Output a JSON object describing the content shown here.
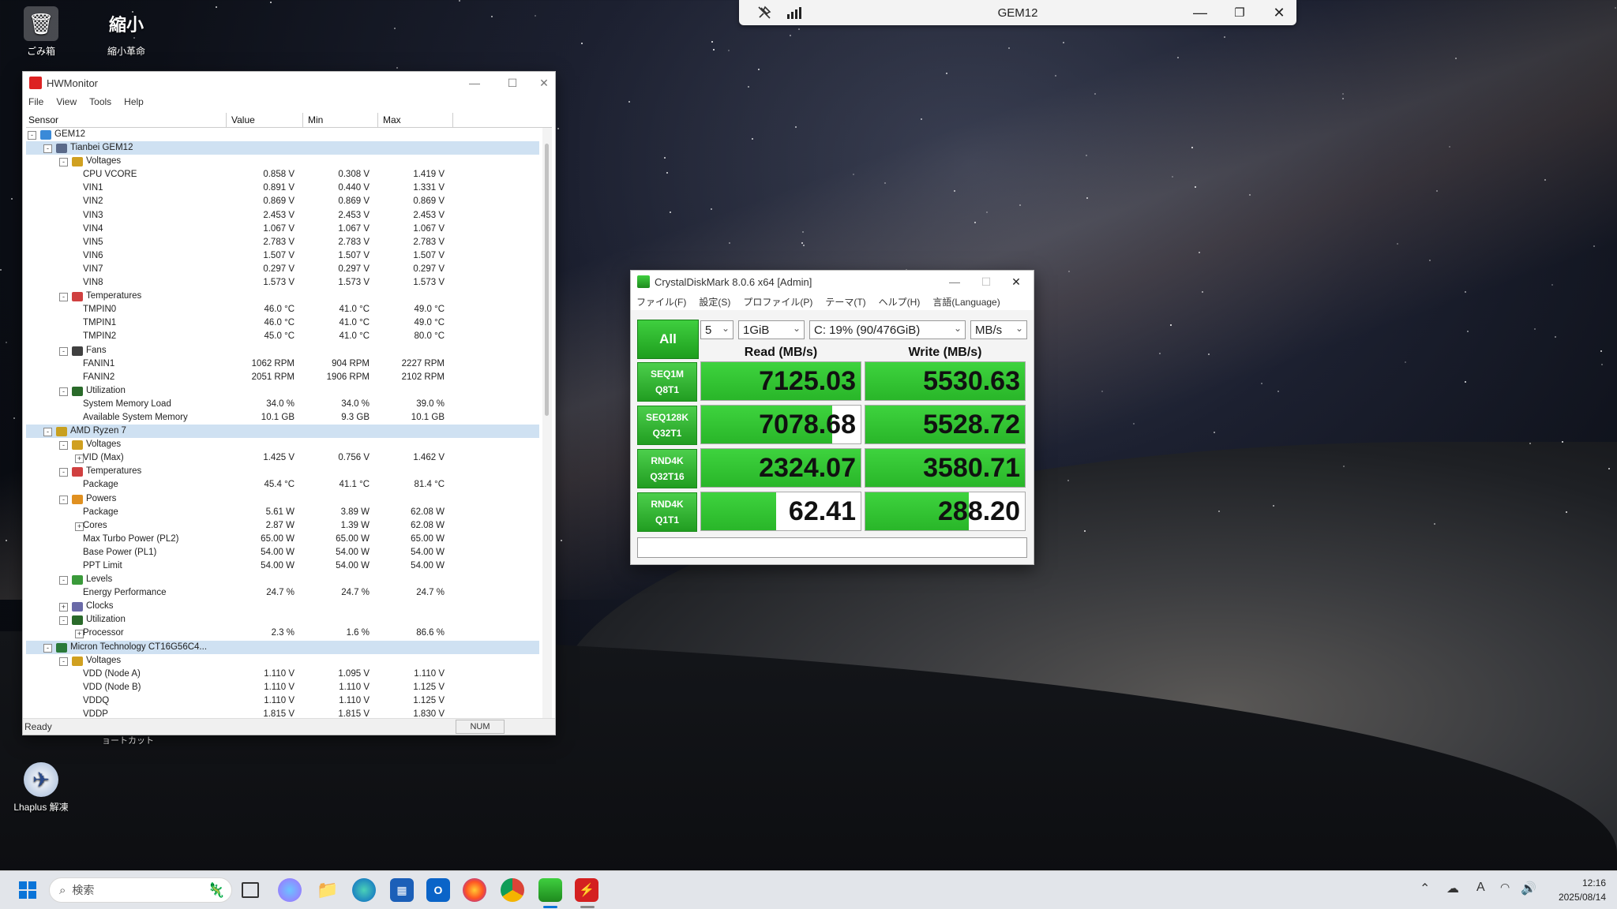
{
  "desktop": {
    "icons": [
      {
        "label": "ごみ箱",
        "icon": "recycle-bin-icon"
      },
      {
        "label": "縮小革命",
        "icon": "app-shortcut-icon"
      },
      {
        "label": "Lhaplus 解凍",
        "icon": "lhaplus-icon"
      }
    ],
    "shortcut_text": "ョートカット"
  },
  "remote_bar": {
    "title": "GEM12",
    "icons": [
      "pin-off-icon",
      "signal-bars-icon",
      "minimize-icon",
      "restore-icon",
      "close-icon"
    ]
  },
  "hwmonitor": {
    "title": "HWMonitor",
    "menu": [
      "File",
      "View",
      "Tools",
      "Help"
    ],
    "columns": [
      "Sensor",
      "Value",
      "Min",
      "Max"
    ],
    "status": "Ready",
    "num_indicator": "NUM",
    "rows": [
      {
        "level": 0,
        "exp": "-",
        "icon": "computer",
        "name": "GEM12",
        "sel": false
      },
      {
        "level": 1,
        "exp": "-",
        "icon": "board",
        "name": "Tianbei GEM12",
        "sel": true
      },
      {
        "level": 2,
        "exp": "-",
        "icon": "volt",
        "name": "Voltages"
      },
      {
        "level": 3,
        "name": "CPU VCORE",
        "value": "0.858 V",
        "min": "0.308 V",
        "max": "1.419 V"
      },
      {
        "level": 3,
        "name": "VIN1",
        "value": "0.891 V",
        "min": "0.440 V",
        "max": "1.331 V"
      },
      {
        "level": 3,
        "name": "VIN2",
        "value": "0.869 V",
        "min": "0.869 V",
        "max": "0.869 V"
      },
      {
        "level": 3,
        "name": "VIN3",
        "value": "2.453 V",
        "min": "2.453 V",
        "max": "2.453 V"
      },
      {
        "level": 3,
        "name": "VIN4",
        "value": "1.067 V",
        "min": "1.067 V",
        "max": "1.067 V"
      },
      {
        "level": 3,
        "name": "VIN5",
        "value": "2.783 V",
        "min": "2.783 V",
        "max": "2.783 V"
      },
      {
        "level": 3,
        "name": "VIN6",
        "value": "1.507 V",
        "min": "1.507 V",
        "max": "1.507 V"
      },
      {
        "level": 3,
        "name": "VIN7",
        "value": "0.297 V",
        "min": "0.297 V",
        "max": "0.297 V"
      },
      {
        "level": 3,
        "name": "VIN8",
        "value": "1.573 V",
        "min": "1.573 V",
        "max": "1.573 V"
      },
      {
        "level": 2,
        "exp": "-",
        "icon": "temp",
        "name": "Temperatures"
      },
      {
        "level": 3,
        "name": "TMPIN0",
        "value": "46.0 °C",
        "min": "41.0 °C",
        "max": "49.0 °C"
      },
      {
        "level": 3,
        "name": "TMPIN1",
        "value": "46.0 °C",
        "min": "41.0 °C",
        "max": "49.0 °C"
      },
      {
        "level": 3,
        "name": "TMPIN2",
        "value": "45.0 °C",
        "min": "41.0 °C",
        "max": "80.0 °C"
      },
      {
        "level": 2,
        "exp": "-",
        "icon": "fan",
        "name": "Fans"
      },
      {
        "level": 3,
        "name": "FANIN1",
        "value": "1062 RPM",
        "min": "904 RPM",
        "max": "2227 RPM"
      },
      {
        "level": 3,
        "name": "FANIN2",
        "value": "2051 RPM",
        "min": "1906 RPM",
        "max": "2102 RPM"
      },
      {
        "level": 2,
        "exp": "-",
        "icon": "util",
        "name": "Utilization"
      },
      {
        "level": 3,
        "name": "System Memory Load",
        "value": "34.0 %",
        "min": "34.0 %",
        "max": "39.0 %"
      },
      {
        "level": 3,
        "name": "Available System Memory",
        "value": "10.1 GB",
        "min": "9.3 GB",
        "max": "10.1 GB"
      },
      {
        "level": 1,
        "exp": "-",
        "icon": "cpu",
        "name": "AMD Ryzen 7",
        "sel": true
      },
      {
        "level": 2,
        "exp": "-",
        "icon": "volt",
        "name": "Voltages"
      },
      {
        "level": 3,
        "exp": "+",
        "name": "VID (Max)",
        "value": "1.425 V",
        "min": "0.756 V",
        "max": "1.462 V"
      },
      {
        "level": 2,
        "exp": "-",
        "icon": "temp",
        "name": "Temperatures"
      },
      {
        "level": 3,
        "name": "Package",
        "value": "45.4 °C",
        "min": "41.1 °C",
        "max": "81.4 °C"
      },
      {
        "level": 2,
        "exp": "-",
        "icon": "power",
        "name": "Powers"
      },
      {
        "level": 3,
        "name": "Package",
        "value": "5.61 W",
        "min": "3.89 W",
        "max": "62.08 W"
      },
      {
        "level": 3,
        "exp": "+",
        "name": "Cores",
        "value": "2.87 W",
        "min": "1.39 W",
        "max": "62.08 W"
      },
      {
        "level": 3,
        "name": "Max Turbo Power (PL2)",
        "value": "65.00 W",
        "min": "65.00 W",
        "max": "65.00 W"
      },
      {
        "level": 3,
        "name": "Base Power (PL1)",
        "value": "54.00 W",
        "min": "54.00 W",
        "max": "54.00 W"
      },
      {
        "level": 3,
        "name": "PPT Limit",
        "value": "54.00 W",
        "min": "54.00 W",
        "max": "54.00 W"
      },
      {
        "level": 2,
        "exp": "-",
        "icon": "levels",
        "name": "Levels"
      },
      {
        "level": 3,
        "name": "Energy Performance",
        "value": "24.7 %",
        "min": "24.7 %",
        "max": "24.7 %"
      },
      {
        "level": 2,
        "exp": "+",
        "icon": "clock",
        "name": "Clocks"
      },
      {
        "level": 2,
        "exp": "-",
        "icon": "util",
        "name": "Utilization"
      },
      {
        "level": 3,
        "exp": "+",
        "name": "Processor",
        "value": "2.3 %",
        "min": "1.6 %",
        "max": "86.6 %"
      },
      {
        "level": 1,
        "exp": "-",
        "icon": "ram",
        "name": "Micron Technology CT16G56C4...",
        "sel": true
      },
      {
        "level": 2,
        "exp": "-",
        "icon": "volt",
        "name": "Voltages"
      },
      {
        "level": 3,
        "name": "VDD (Node A)",
        "value": "1.110 V",
        "min": "1.095 V",
        "max": "1.110 V"
      },
      {
        "level": 3,
        "name": "VDD (Node B)",
        "value": "1.110 V",
        "min": "1.110 V",
        "max": "1.125 V"
      },
      {
        "level": 3,
        "name": "VDDQ",
        "value": "1.110 V",
        "min": "1.110 V",
        "max": "1.125 V"
      },
      {
        "level": 3,
        "name": "VDDP",
        "value": "1.815 V",
        "min": "1.815 V",
        "max": "1.830 V"
      }
    ]
  },
  "cdm": {
    "title": "CrystalDiskMark 8.0.6 x64 [Admin]",
    "menu": [
      "ファイル(F)",
      "設定(S)",
      "プロファイル(P)",
      "テーマ(T)",
      "ヘルプ(H)",
      "言語(Language)"
    ],
    "all_button": "All",
    "count": "5",
    "size": "1GiB",
    "drive": "C: 19% (90/476GiB)",
    "unit": "MB/s",
    "read_header": "Read (MB/s)",
    "write_header": "Write (MB/s)",
    "tests": [
      {
        "l1": "SEQ1M",
        "l2": "Q8T1",
        "read": "7125.03",
        "write": "5530.63",
        "read_fill": 1.0,
        "write_fill": 1.0
      },
      {
        "l1": "SEQ128K",
        "l2": "Q32T1",
        "read": "7078.68",
        "write": "5528.72",
        "read_fill": 0.82,
        "write_fill": 1.0
      },
      {
        "l1": "RND4K",
        "l2": "Q32T16",
        "read": "2324.07",
        "write": "3580.71",
        "read_fill": 1.0,
        "write_fill": 1.0
      },
      {
        "l1": "RND4K",
        "l2": "Q1T1",
        "read": "62.41",
        "write": "288.20",
        "read_fill": 0.47,
        "write_fill": 0.65
      }
    ]
  },
  "taskbar": {
    "search_placeholder": "検索",
    "time": "12:16",
    "date": "2025/08/14",
    "ime": "A"
  }
}
